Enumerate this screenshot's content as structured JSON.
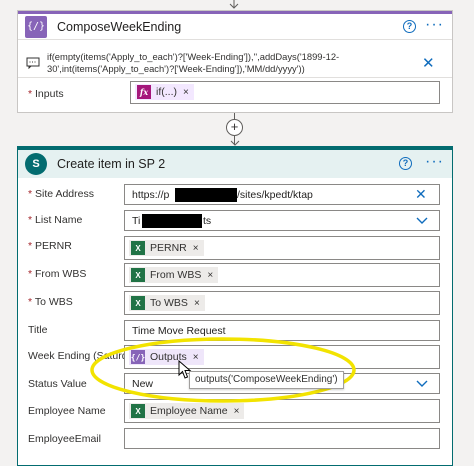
{
  "colors": {
    "compose_accent": "#8764b8",
    "sharepoint_accent": "#036c70",
    "link_blue": "#0f6cbd",
    "highlight_yellow": "#f2e300",
    "required_red": "#a4262c"
  },
  "compose": {
    "title": "ComposeWeekEnding",
    "icon": "compose-braces-icon",
    "expression_line1": "if(empty(items('Apply_to_each')?['Week-Ending']),'',addDays('1899-12-",
    "expression_line2": "30',int(items('Apply_to_each')?['Week-Ending']),'MM/dd/yyyy'))",
    "inputs_label": "Inputs",
    "inputs_chip": "if(...)",
    "inputs_chip_icon": "fx-icon"
  },
  "create_item": {
    "title": "Create item in SP 2",
    "icon": "sharepoint-icon",
    "fields": {
      "site_address": {
        "label": "Site Address",
        "value_prefix": "https://p",
        "value_suffix": "/sites/kpedt/ktap"
      },
      "list_name": {
        "label": "List Name",
        "value_prefix": "Ti",
        "value_suffix": "ts"
      },
      "pernr": {
        "label": "PERNR",
        "chip": "PERNR"
      },
      "from_wbs": {
        "label": "From WBS",
        "chip": "From WBS"
      },
      "to_wbs": {
        "label": "To WBS",
        "chip": "To WBS"
      },
      "title": {
        "label": "Title",
        "value": "Time Move Request"
      },
      "week_ending": {
        "label": "Week Ending (Saturday)",
        "chip": "Outputs"
      },
      "status_value": {
        "label": "Status Value",
        "value": "New"
      },
      "employee_name": {
        "label": "Employee Name",
        "chip": "Employee Name"
      },
      "employee_email": {
        "label": "EmployeeEmail"
      }
    },
    "tooltip": "outputs('ComposeWeekEnding')"
  },
  "connector": {
    "add_icon": "plus-icon"
  },
  "symbols": {
    "close": "×",
    "help": "?",
    "more": "···",
    "required_mark": "*",
    "fx": "fx",
    "braces": "{/}",
    "chevron": "⌄",
    "x_mark": "✕",
    "plus": "+"
  }
}
